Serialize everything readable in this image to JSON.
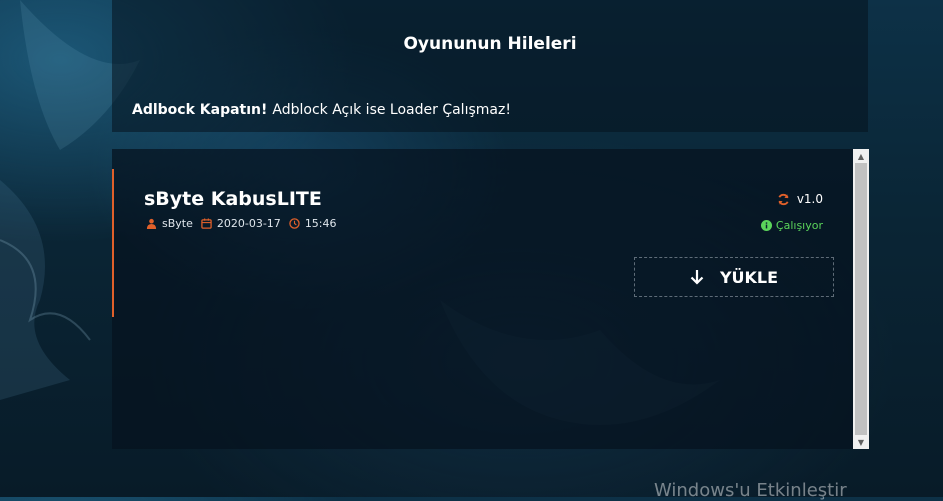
{
  "header": {
    "title": "Oyununun Hileleri"
  },
  "notice": {
    "bold": "Adlbock Kapatın!",
    "text": "Adblock Açık ise Loader Çalışmaz!"
  },
  "items": [
    {
      "name": "sByte KabusLITE",
      "author": "sByte",
      "date": "2020-03-17",
      "time": "15:46",
      "version": "v1.0",
      "status": "Çalışıyor",
      "button_label": "YÜKLE"
    }
  ],
  "watermark": "Windows'u Etkinleştir",
  "colors": {
    "accent": "#e0602a",
    "status_ok": "#5bd45b"
  }
}
